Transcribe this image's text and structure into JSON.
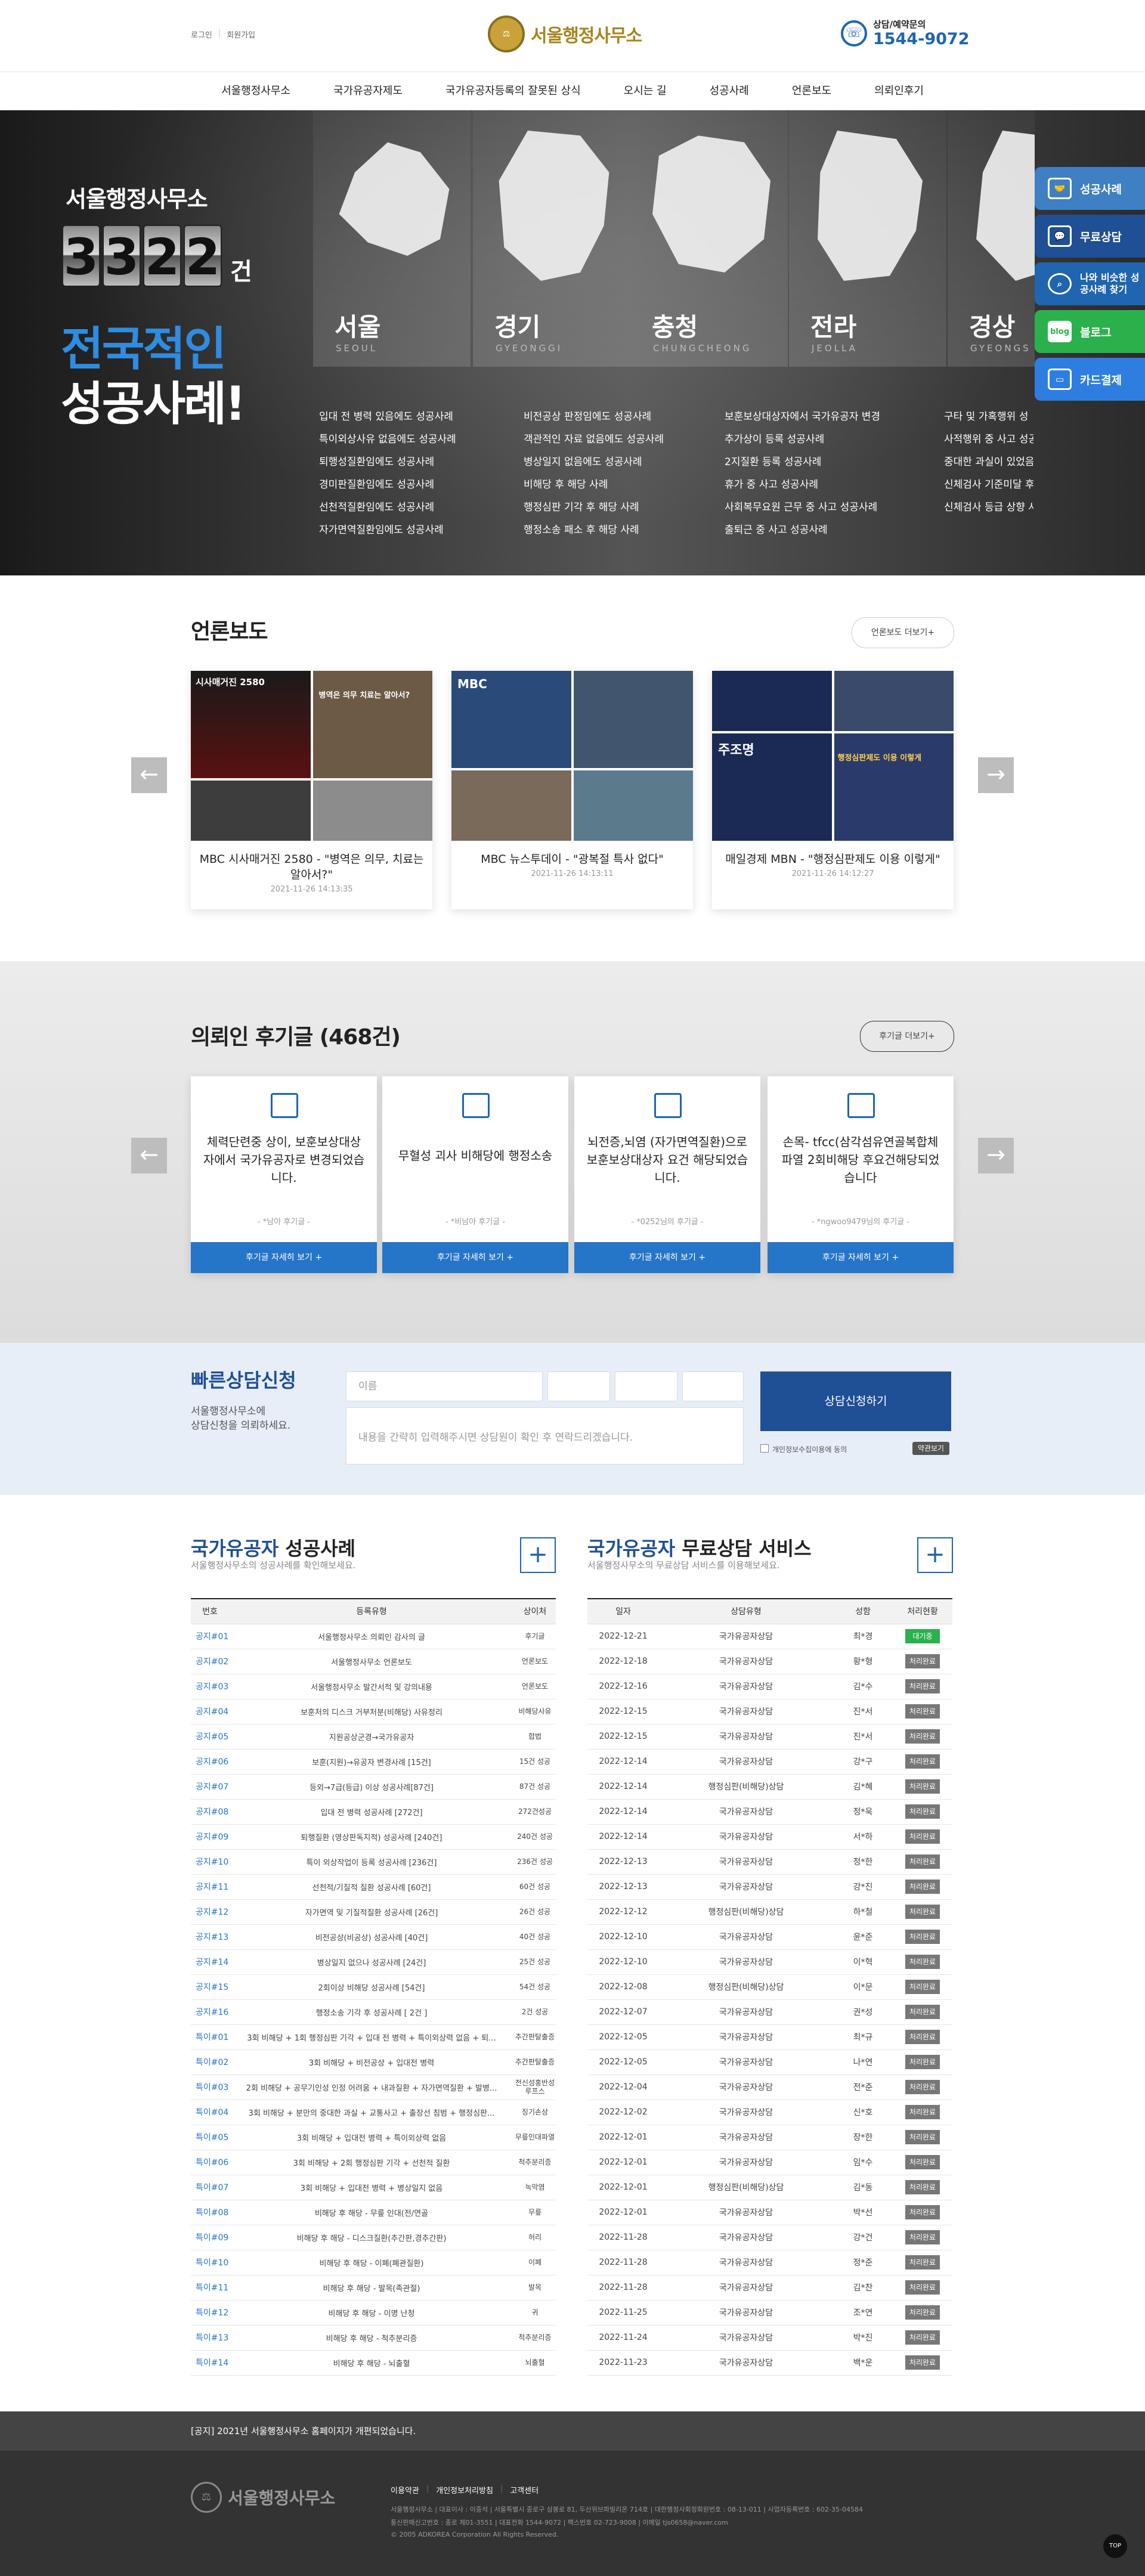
{
  "header": {
    "util": [
      "로그인",
      "회원가입"
    ],
    "logo_text": "서울행정사무소",
    "call_label": "상담/예약문의",
    "call_number": "1544-9072"
  },
  "gnb": [
    "서울행정사무소",
    "국가유공자제도",
    "국가유공자등록의 잘못된 상식",
    "오시는 길",
    "성공사례",
    "언론보도",
    "의뢰인후기"
  ],
  "hero": {
    "line1": "서울행정사무소",
    "digits": [
      "3",
      "3",
      "2",
      "2"
    ],
    "unit": "건",
    "line3": "전국적인",
    "line4": "성공사례!",
    "regions": [
      {
        "name": "서울",
        "en": "SEOUL"
      },
      {
        "name": "경기",
        "en": "GYEONGGI"
      },
      {
        "name": "충청",
        "en": "CHUNGCHEONG"
      },
      {
        "name": "전라",
        "en": "JEOLLA"
      },
      {
        "name": "경상",
        "en": "GYEONGS"
      }
    ],
    "cases": [
      [
        "입대 전 병력 있음에도 성공사례",
        "특이외상사유 없음에도 성공사례",
        "퇴행성질환임에도 성공사례",
        "경미판질환임에도 성공사례",
        "선천적질환임에도 성공사례",
        "자가면역질환임에도 성공사례"
      ],
      [
        "비전공상 판정임에도 성공사례",
        "객관적인 자료 없음에도 성공사례",
        "병상일지 없음에도 성공사례",
        "비해당 후 해당 사례",
        "행정심판 기각 후 해당 사례",
        "행정소송 패소 후 해당 사례"
      ],
      [
        "보훈보상대상자에서 국가유공자 변경",
        "추가상이 등록 성공사례",
        "2지질환 등록 성공사례",
        "휴가 중 사고 성공사례",
        "사회복무요원 근무 중 사고 성공사례",
        "출퇴근 중 사고 성공사례"
      ],
      [
        "구타 및 가혹행위 성",
        "사적행위 중 사고 성공사례",
        "중대한 과실이 있었음에도 성공사례",
        "신체검사 기준미달 후 등급판정사례",
        "신체검사 등급 상향 사례"
      ]
    ]
  },
  "quick": [
    {
      "label": "성공사례",
      "icon": "handshake-icon",
      "color": "#3f7fc4"
    },
    {
      "label": "무료상담",
      "icon": "chat-icon",
      "color": "#1f4f95"
    },
    {
      "label": "나와 비슷한 성공사례 찾기",
      "icon": "search-icon",
      "color": "#1f65b0"
    },
    {
      "label": "블로그",
      "icon": "blog-icon",
      "color": "#2bb14c",
      "badge": "blog"
    },
    {
      "label": "카드결제",
      "icon": "card-icon",
      "color": "#2d7ee0"
    }
  ],
  "press": {
    "title": "언론보도",
    "more": "언론보도 더보기+",
    "items": [
      {
        "title": "MBC 시사매거진 2580 - \"병역은 의무, 치료는 알아서?\"",
        "date": "2021-11-26 14:13:35",
        "overlay": [
          "시사매거진 2580",
          "병역은 의무 치료는 알아서?"
        ]
      },
      {
        "title": "MBC 뉴스투데이 - \"광복절 특사 없다\"",
        "date": "2021-11-26 14:13:11",
        "overlay": [
          "MBC"
        ]
      },
      {
        "title": "매일경제 MBN - \"행정심판제도 이용 이렇게\"",
        "date": "2021-11-26 14:12:27",
        "overlay": [
          "주조명",
          "행정심판제도 이용 이렇게"
        ]
      }
    ]
  },
  "reviews": {
    "title": "의뢰인 후기글 (468건)",
    "more": "후기글 더보기+",
    "items": [
      {
        "text": "체력단련중 상이, 보훈보상대상자에서 국가유공자로 변경되었습니다.",
        "name": "- *남아 후기글 -",
        "btn": "후기글 자세히 보기 +"
      },
      {
        "text": "무혈성 괴사 비해당에 행정소송",
        "name": "- *비남아 후기글 -",
        "btn": "후기글 자세히 보기 +"
      },
      {
        "text": "뇌전증,뇌염 (자가면역질환)으로 보훈보상대상자 요건 해당되었습니다.",
        "name": "- *0252님의 후기글 -",
        "btn": "후기글 자세히 보기 +"
      },
      {
        "text": "손목- tfcc(삼각섬유연골복합체파열 2회비해당 후요건해당되었습니다",
        "name": "- *ngwoo9479님의 후기글 -",
        "btn": "후기글 자세히 보기 +"
      }
    ]
  },
  "consult": {
    "title": "빠른상담신청",
    "sub1": "서울행정사무소에",
    "sub2": "상담신청을 의뢰하세요.",
    "name_placeholder": "이름",
    "msg_placeholder": "내용을 간략히 입력해주시면 상담원이 확인 후 연락드리겠습니다.",
    "submit": "상담신청하기",
    "agree": "개인정보수집이용에 동의",
    "view": "약관보기"
  },
  "cases_table": {
    "title_a": "국가유공자",
    "title_b": " 성공사례",
    "sub": "서울행정사무소의 성공사례를 확인해보세요.",
    "headers": [
      "번호",
      "등록유형",
      "상이처"
    ],
    "rows": [
      [
        "공지#01",
        "서울행정사무소 의뢰인 감사의 글",
        "후기글"
      ],
      [
        "공지#02",
        "서울행정사무소 언론보도",
        "언론보도"
      ],
      [
        "공지#03",
        "서울행정사무소 발간서적 및 강의내용",
        "언론보도"
      ],
      [
        "공지#04",
        "보훈처의 디스크 거부처분(비해당) 사유정리",
        "비해당사유"
      ],
      [
        "공지#05",
        "지원공상군경→국가유공자",
        "합법"
      ],
      [
        "공지#06",
        "보훈(지원)→유공자 변경사례 [15건]",
        "15건 성공"
      ],
      [
        "공지#07",
        "등외→7급(등급) 이상 성공사례[87건]",
        "87건 성공"
      ],
      [
        "공지#08",
        "입대 전 병력 성공사례 [272건]",
        "272건성공"
      ],
      [
        "공지#09",
        "퇴행질환 (영상판독지적) 성공사례 [240건]",
        "240건 성공"
      ],
      [
        "공지#10",
        "특이 외상작업이 등록 성공사례 [236건]",
        "236건 성공"
      ],
      [
        "공지#11",
        "선천적/기질적 질환 성공사례 [60건]",
        "60건 성공"
      ],
      [
        "공지#12",
        "자가면역 및 기질적질환 성공사례 [26건]",
        "26건 성공"
      ],
      [
        "공지#13",
        "비전공상(비공상) 성공사례 [40건]",
        "40건 성공"
      ],
      [
        "공지#14",
        "병상일지 없으나 성공사례 [24건]",
        "25건 성공"
      ],
      [
        "공지#15",
        "2회이상 비해당 성공사례 [54건]",
        "54건 성공"
      ],
      [
        "공지#16",
        "행정소송 기각 후 성공사례 [ 2건 ]",
        "2건 성공"
      ],
      [
        "특이#01",
        "3회 비해당 + 1회 행정심판 기각 + 입대 전 병력 + 특이외상력 없음 + 퇴...",
        "추간판탈출증"
      ],
      [
        "특이#02",
        "3회 비해당 + 비전공상 + 입대전 병력",
        "추간판탈출증"
      ],
      [
        "특이#03",
        "2회 비해당 + 공무기인성 인정 어려움 + 내과질환 + 자가면역질환 + 발병...",
        "전신성홍반성루프스"
      ],
      [
        "특이#04",
        "3회 비해당 + 분만의 중대한 과실 + 교통사고 + 출장선 침범 + 행정심판...",
        "징기손상"
      ],
      [
        "특이#05",
        "3회 비해당 + 입대전 병력 + 특이외상력 없음",
        "무릎인대파열"
      ],
      [
        "특이#06",
        "3회 비해당 + 2회 행정심판 기각 + 선천적 질환",
        "척추분리증"
      ],
      [
        "특이#07",
        "3회 비해당 + 입대전 병력 + 병상일지 없음",
        "녹막염"
      ],
      [
        "특이#08",
        "비해당 후 해당 - 무릎 인대(전/연골",
        "무릎"
      ],
      [
        "특이#09",
        "비해당 후 해당 - 디스크질환(추간판,경추간판)",
        "허리"
      ],
      [
        "특이#10",
        "비해당 후 해당 - 이폐(폐관질환)",
        "이폐"
      ],
      [
        "특이#11",
        "비해당 후 해당 - 발목(족관절)",
        "발목"
      ],
      [
        "특이#12",
        "비해당 후 해당 - 이명 난청",
        "귀"
      ],
      [
        "특이#13",
        "비해당 후 해당 - 척추분리증",
        "척추분리증"
      ],
      [
        "특이#14",
        "비해당 후 해당 - 뇌출혈",
        "뇌출혈"
      ]
    ]
  },
  "consult_table": {
    "title_a": "국가유공자",
    "title_b": " 무료상담 서비스",
    "sub": "서울행정사무소의 무료상담 서비스를 이용해보세요.",
    "headers": [
      "일자",
      "상담유형",
      "성함",
      "처리현황"
    ],
    "rows": [
      [
        "2022-12-21",
        "국가유공자상담",
        "최*경",
        "대기중"
      ],
      [
        "2022-12-18",
        "국가유공자상담",
        "황*형",
        "처리완료"
      ],
      [
        "2022-12-16",
        "국가유공자상담",
        "김*수",
        "처리완료"
      ],
      [
        "2022-12-15",
        "국가유공자상담",
        "진*서",
        "처리완료"
      ],
      [
        "2022-12-15",
        "국가유공자상담",
        "진*서",
        "처리완료"
      ],
      [
        "2022-12-14",
        "국가유공자상담",
        "강*구",
        "처리완료"
      ],
      [
        "2022-12-14",
        "행정심판(비해당)상담",
        "김*혜",
        "처리완료"
      ],
      [
        "2022-12-14",
        "국가유공자상담",
        "정*욱",
        "처리완료"
      ],
      [
        "2022-12-14",
        "국가유공자상담",
        "서*하",
        "처리완료"
      ],
      [
        "2022-12-13",
        "국가유공자상담",
        "정*한",
        "처리완료"
      ],
      [
        "2022-12-13",
        "국가유공자상담",
        "강*진",
        "처리완료"
      ],
      [
        "2022-12-12",
        "행정심판(비해당)상담",
        "하*철",
        "처리완료"
      ],
      [
        "2022-12-10",
        "국가유공자상담",
        "윤*준",
        "처리완료"
      ],
      [
        "2022-12-10",
        "국가유공자상담",
        "이*혁",
        "처리완료"
      ],
      [
        "2022-12-08",
        "행정심판(비해당)상담",
        "이*문",
        "처리완료"
      ],
      [
        "2022-12-07",
        "국가유공자상담",
        "권*성",
        "처리완료"
      ],
      [
        "2022-12-05",
        "국가유공자상담",
        "최*규",
        "처리완료"
      ],
      [
        "2022-12-05",
        "국가유공자상담",
        "나*연",
        "처리완료"
      ],
      [
        "2022-12-04",
        "국가유공자상담",
        "전*준",
        "처리완료"
      ],
      [
        "2022-12-02",
        "국가유공자상담",
        "신*호",
        "처리완료"
      ],
      [
        "2022-12-01",
        "국가유공자상담",
        "장*한",
        "처리완료"
      ],
      [
        "2022-12-01",
        "국가유공자상담",
        "임*수",
        "처리완료"
      ],
      [
        "2022-12-01",
        "행정심판(비해당)상담",
        "김*동",
        "처리완료"
      ],
      [
        "2022-12-01",
        "국가유공자상담",
        "박*선",
        "처리완료"
      ],
      [
        "2022-11-28",
        "국가유공자상담",
        "강*건",
        "처리완료"
      ],
      [
        "2022-11-28",
        "국가유공자상담",
        "정*준",
        "처리완료"
      ],
      [
        "2022-11-28",
        "국가유공자상담",
        "김*찬",
        "처리완료"
      ],
      [
        "2022-11-25",
        "국가유공자상담",
        "조*연",
        "처리완료"
      ],
      [
        "2022-11-24",
        "국가유공자상담",
        "박*진",
        "처리완료"
      ],
      [
        "2022-11-23",
        "국가유공자상담",
        "백*운",
        "처리완료"
      ]
    ]
  },
  "notice": "[공지] 2021년 서울행정사무소 홈페이지가 개편되었습니다.",
  "footer": {
    "logo_text": "서울행정사무소",
    "links": [
      "이용약관",
      "개인정보처리방침",
      "고객센터"
    ],
    "info1": "서울행정사무소 | 대표이사 : 이종석 | 서울특별시 종로구 삼봉로 81, 두산위브파빌리온 714호 | 대한행정사회정회원번호 : 08-13-011 | 사업자등록번호 : 602-35-04584",
    "info2": "통신판매신고번호 : 종로 제01-3551 | 대표전화 1544-9072 | 팩스번호 02-723-9008 | 이메일 tjs0658@naver.com",
    "copyright": "© 2005 ADKOREA Corporation All Rights Reserved.",
    "top": "TOP"
  }
}
